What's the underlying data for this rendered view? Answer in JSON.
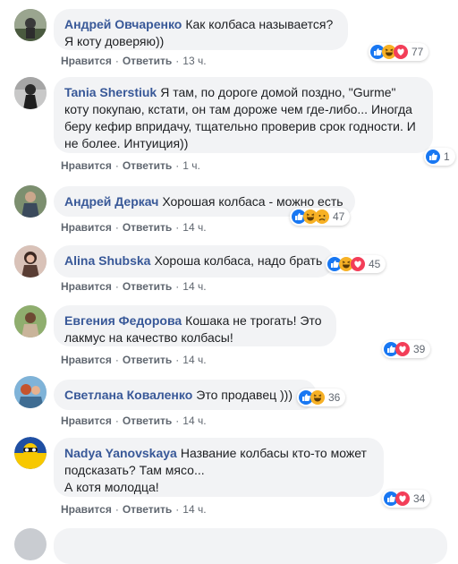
{
  "comments": [
    {
      "author": "Андрей Овчаренко",
      "text": "Как колбаса называется? Я коту доверяю))",
      "like_label": "Нравится",
      "reply_label": "Ответить",
      "time": "13 ч.",
      "reactions": [
        "like",
        "haha",
        "love"
      ],
      "reaction_count": "77"
    },
    {
      "author": "Tania Sherstiuk",
      "text": "Я там, по дороге домой поздно, \"Gurme\" коту покупаю, кстати, он там дороже чем где-либо... Иногда беру кефир впридачу, тщательно проверив срок годности. И не более. Интуиция))",
      "like_label": "Нравится",
      "reply_label": "Ответить",
      "time": "1 ч.",
      "reactions": [
        "like"
      ],
      "reaction_count": "1"
    },
    {
      "author": "Андрей Деркач",
      "text": "Хорошая колбаса - можно есть",
      "like_label": "Нравится",
      "reply_label": "Ответить",
      "time": "14 ч.",
      "reactions": [
        "like",
        "haha",
        "sad"
      ],
      "reaction_count": "47"
    },
    {
      "author": "Alina Shubska",
      "text": "Хороша колбаса, надо брать",
      "like_label": "Нравится",
      "reply_label": "Ответить",
      "time": "14 ч.",
      "reactions": [
        "like",
        "haha",
        "love"
      ],
      "reaction_count": "45"
    },
    {
      "author": "Евгения Федорова",
      "text": "Кошака не трогать! Это лакмус на качество колбасы!",
      "like_label": "Нравится",
      "reply_label": "Ответить",
      "time": "14 ч.",
      "reactions": [
        "like",
        "love"
      ],
      "reaction_count": "39"
    },
    {
      "author": "Светлана Коваленко",
      "text": "Это продавец )))",
      "like_label": "Нравится",
      "reply_label": "Ответить",
      "time": "14 ч.",
      "reactions": [
        "like",
        "haha"
      ],
      "reaction_count": "36"
    },
    {
      "author": "Nadya Yanovskaya",
      "text": "Название колбасы кто-то может подсказать? Там мясо...",
      "text2": "А котя молодца!",
      "like_label": "Нравится",
      "reply_label": "Ответить",
      "time": "14 ч.",
      "reactions": [
        "like",
        "love"
      ],
      "reaction_count": "34"
    }
  ],
  "colors": {
    "author": "#385898",
    "bubble": "#f2f3f5",
    "like": "#1877f2",
    "love": "#f33e58",
    "haha": "#f7b125"
  }
}
